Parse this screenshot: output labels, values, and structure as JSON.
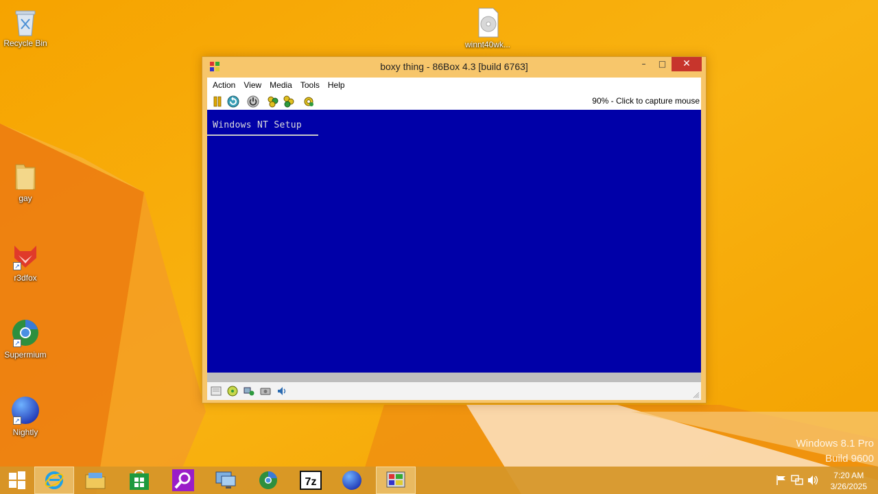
{
  "desktop": {
    "icons": [
      {
        "label": "Recycle Bin"
      },
      {
        "label": "winnt40wk..."
      },
      {
        "label": "gay"
      },
      {
        "label": "r3dfox"
      },
      {
        "label": "Supermium"
      },
      {
        "label": "Nightly"
      }
    ],
    "watermark": {
      "line1": "Windows 8.1 Pro",
      "line2": "Build 9600"
    }
  },
  "window": {
    "title": "boxy thing - 86Box 4.3 [build 6763]",
    "controls": {
      "minimize": "–",
      "maximize": "□",
      "close": "✕"
    },
    "menu": [
      "Action",
      "View",
      "Media",
      "Tools",
      "Help"
    ],
    "toolbar": {
      "buttons": [
        "pause-icon",
        "reset-icon",
        "power-icon",
        "settings-icon",
        "cad-icon",
        "ctrl-alt-esc-icon"
      ],
      "capture_text": "90% - Click to capture mouse"
    },
    "screen": {
      "setup_title": "Windows NT Setup",
      "background": "#0000a8"
    },
    "statusbar": {
      "icons": [
        "floppy-icon",
        "cdrom-icon",
        "network-icon",
        "hdd-icon",
        "sound-icon"
      ]
    }
  },
  "taskbar": {
    "items": [
      "start-button",
      "internet-explorer",
      "file-explorer",
      "store",
      "search-app",
      "remote-desktop",
      "supermium",
      "7zip",
      "nightly",
      "86box"
    ],
    "clock": {
      "time": "7:20 AM",
      "date": "3/26/2025"
    }
  },
  "colors": {
    "accent": "#f5a100",
    "vm_blue": "#0000a8",
    "close_red": "#c7352c"
  }
}
